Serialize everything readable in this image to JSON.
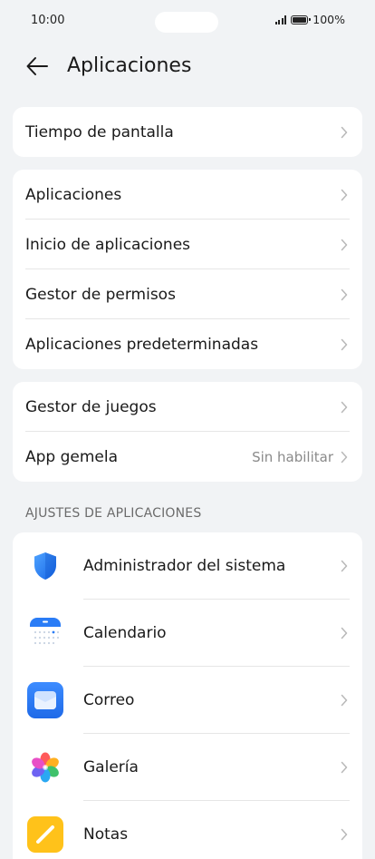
{
  "status_bar": {
    "time": "10:00",
    "battery": "100%"
  },
  "header": {
    "title": "Aplicaciones"
  },
  "groups": [
    {
      "items": [
        {
          "label": "Tiempo de pantalla"
        }
      ]
    },
    {
      "items": [
        {
          "label": "Aplicaciones"
        },
        {
          "label": "Inicio de aplicaciones"
        },
        {
          "label": "Gestor de permisos"
        },
        {
          "label": "Aplicaciones predeterminadas"
        }
      ]
    },
    {
      "items": [
        {
          "label": "Gestor de juegos"
        },
        {
          "label": "App gemela",
          "value": "Sin habilitar"
        }
      ]
    }
  ],
  "app_settings": {
    "section_title": "AJUSTES DE APLICACIONES",
    "apps": [
      {
        "label": "Administrador del sistema",
        "icon": "shield-icon"
      },
      {
        "label": "Calendario",
        "icon": "calendar-icon"
      },
      {
        "label": "Correo",
        "icon": "mail-icon"
      },
      {
        "label": "Galería",
        "icon": "gallery-icon"
      },
      {
        "label": "Notas",
        "icon": "notes-icon"
      }
    ]
  },
  "colors": {
    "background": "#f1f3f5",
    "card": "#ffffff",
    "secondary_text": "#8a8a8a",
    "accent_blue": "#2a7cf6"
  }
}
